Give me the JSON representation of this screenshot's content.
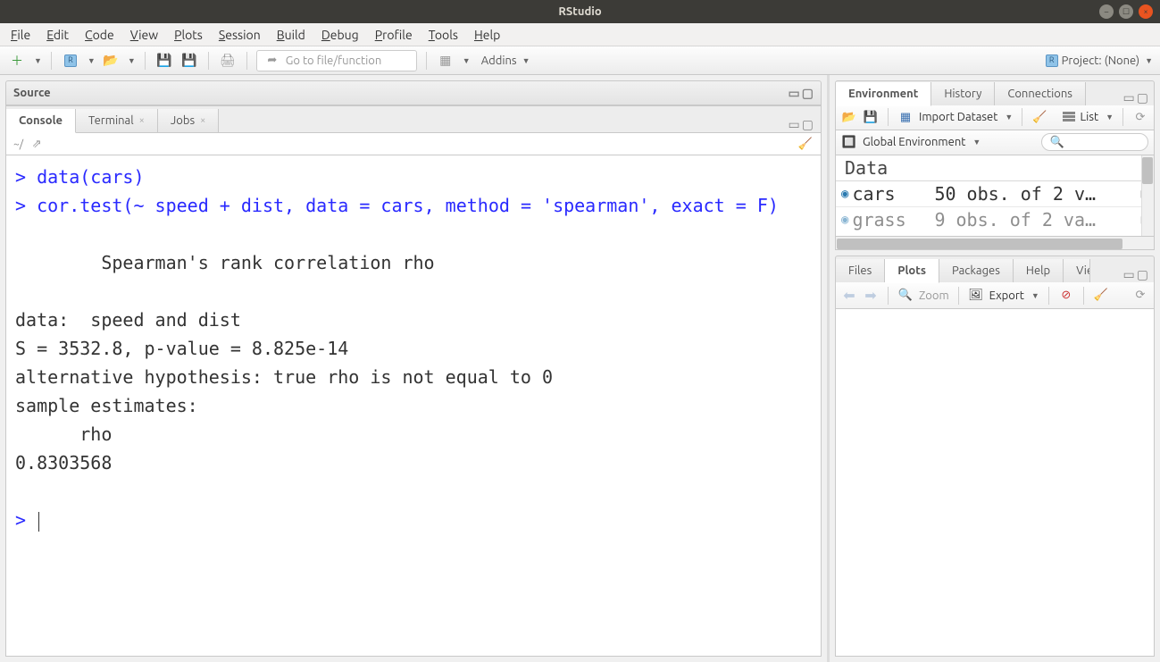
{
  "window": {
    "title": "RStudio"
  },
  "menu": [
    "File",
    "Edit",
    "Code",
    "View",
    "Plots",
    "Session",
    "Build",
    "Debug",
    "Profile",
    "Tools",
    "Help"
  ],
  "toolbar": {
    "goto_placeholder": "Go to file/function",
    "addins_label": "Addins",
    "project_label": "Project: (None)"
  },
  "source_pane": {
    "title": "Source"
  },
  "console_tabs": {
    "items": [
      {
        "label": "Console",
        "closable": false,
        "active": true
      },
      {
        "label": "Terminal",
        "closable": true,
        "active": false
      },
      {
        "label": "Jobs",
        "closable": true,
        "active": false
      }
    ],
    "path_label": "~/"
  },
  "console": {
    "line1": "data(cars)",
    "line2": "cor.test(~ speed + dist, data = cars, method = 'spearman', exact = F)",
    "out1": "\tSpearman's rank correlation rho",
    "out2": "data:  speed and dist",
    "out3": "S = 3532.8, p-value = 8.825e-14",
    "out4": "alternative hypothesis: true rho is not equal to 0",
    "out5": "sample estimates:",
    "out6": "      rho ",
    "out7": "0.8303568 "
  },
  "env_tabs": [
    "Environment",
    "History",
    "Connections"
  ],
  "env_toolbar": {
    "import_label": "Import Dataset",
    "list_label": "List",
    "scope_label": "Global Environment"
  },
  "env_section": "Data",
  "env_rows": [
    {
      "name": "cars",
      "desc": "50 obs. of 2 v…"
    },
    {
      "name": "grass",
      "desc": "9 obs. of 2 va…"
    }
  ],
  "plot_tabs": [
    "Files",
    "Plots",
    "Packages",
    "Help",
    "Viewer"
  ],
  "plot_toolbar": {
    "zoom": "Zoom",
    "export": "Export"
  }
}
